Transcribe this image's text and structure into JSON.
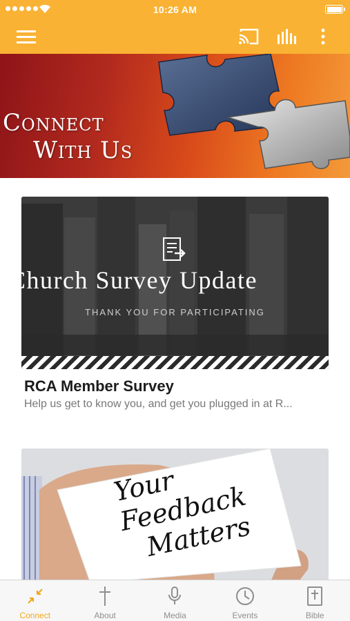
{
  "status_bar": {
    "time": "10:26 AM"
  },
  "colors": {
    "accent": "#F9B233",
    "active_tab": "#F0A81F",
    "inactive_tab": "#8e8e8e"
  },
  "app_bar": {
    "icons": [
      "hamburger-menu-icon",
      "cast-icon",
      "equalizer-icon",
      "more-vert-icon"
    ]
  },
  "hero": {
    "title_line1": "Connect",
    "title_line2": "With Us"
  },
  "cards": [
    {
      "image_headline": "Church Survey Update",
      "image_subtitle": "THANK YOU FOR PARTICIPATING",
      "image_icon": "document-forward-icon",
      "title": "RCA Member Survey",
      "description": "Help us get to know you, and get you plugged in at R..."
    },
    {
      "image_text_line1": "Your",
      "image_text_line2": "Feedback",
      "image_text_line3": "Matters"
    }
  ],
  "tabs": [
    {
      "label": "Connect",
      "icon": "connect-arrows-icon",
      "active": true
    },
    {
      "label": "About",
      "icon": "cross-icon",
      "active": false
    },
    {
      "label": "Media",
      "icon": "microphone-icon",
      "active": false
    },
    {
      "label": "Events",
      "icon": "clock-icon",
      "active": false
    },
    {
      "label": "Bible",
      "icon": "bible-icon",
      "active": false
    }
  ]
}
